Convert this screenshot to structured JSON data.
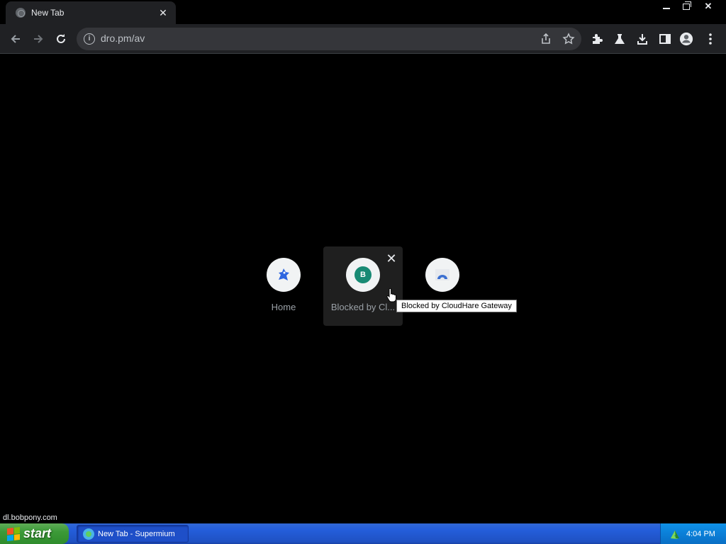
{
  "browser": {
    "tab_title": "New Tab",
    "url": "dro.pm/av"
  },
  "shortcuts": [
    {
      "label": "Home",
      "icon": "mascot-icon"
    },
    {
      "label": "Blocked by Cl...",
      "icon": "letter-b-icon",
      "letter": "B",
      "color": "#188a74"
    },
    {
      "label": "",
      "icon": "cloud-icon"
    }
  ],
  "tooltip": "Blocked by CloudHare Gateway",
  "status_bubble": "dl.bobpony.com",
  "taskbar": {
    "start_label": "start",
    "task_label": "New Tab - Supermium",
    "clock": "4:04 PM"
  },
  "colors": {
    "background": "#000000",
    "toolbar": "#202124",
    "omnibox": "#35363a",
    "taskbar_blue": "#245edb",
    "start_green": "#3c9a38"
  }
}
